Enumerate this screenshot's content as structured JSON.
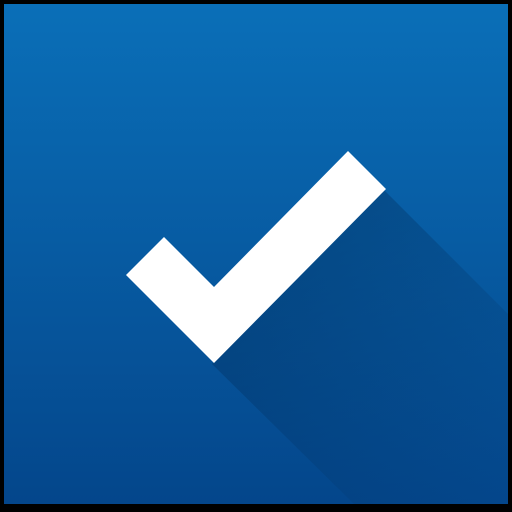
{
  "app_icon": {
    "icon": "checkmark-icon",
    "colors": {
      "background_top": "#0a6fb8",
      "background_bottom": "#04468b",
      "check": "#ffffff",
      "shadow": "#02305f",
      "frame": "#000000"
    }
  }
}
